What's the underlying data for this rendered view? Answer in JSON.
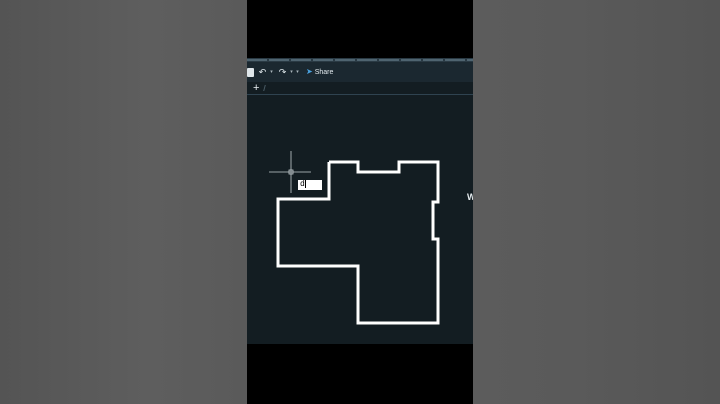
{
  "toolbar": {
    "save_icon": "save-icon",
    "undo_icon": "undo-arrow-icon",
    "redo_icon": "redo-arrow-icon",
    "dropdown_caret": "▾",
    "share_icon": "paper-plane-icon",
    "share_label": "Share"
  },
  "tabs": {
    "new_tab_label": "+"
  },
  "canvas": {
    "background": "#131d22",
    "polyline_color": "#ffffff",
    "command_input_value": "d",
    "crosshair_color": "#c8d0d4",
    "edge_glyph": "W"
  }
}
